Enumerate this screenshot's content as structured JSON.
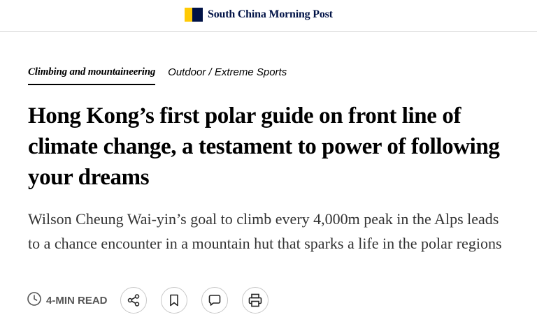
{
  "header": {
    "brand_name": "South China Morning Post",
    "brand_colors": {
      "yellow": "#ffca05",
      "navy": "#001246"
    }
  },
  "article": {
    "sections": {
      "primary": "Climbing and mountaineering",
      "secondary": "Outdoor / Extreme Sports"
    },
    "headline": "Hong Kong’s first polar guide on front line of climate change, a testament to power of following your dreams",
    "summary": "Wilson Cheung Wai-yin’s goal to climb every 4,000m peak in the Alps leads to a chance encounter in a mountain hut that sparks a life in the polar regions",
    "read_time": "4-MIN READ"
  },
  "toolbar": {
    "icons": [
      "clock-icon",
      "share-icon",
      "bookmark-icon",
      "comment-icon",
      "print-icon"
    ]
  }
}
